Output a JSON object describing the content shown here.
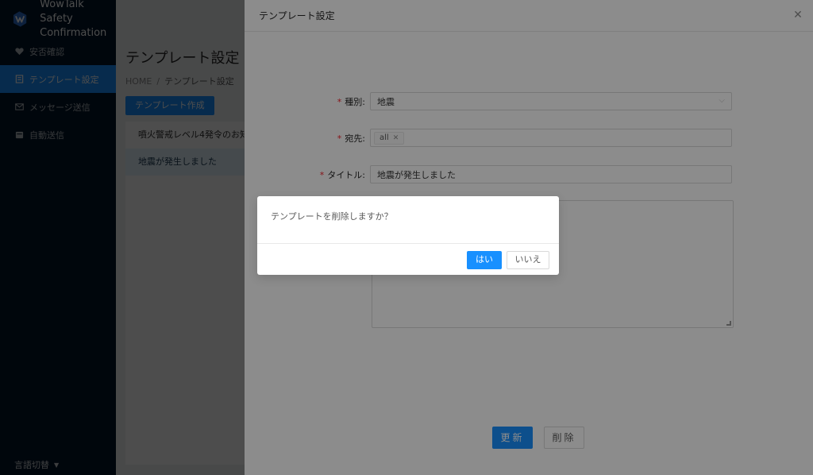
{
  "app": {
    "brand_line1": "WowTalk",
    "brand_line2": "Safety Confirmation",
    "logo_icon": "wowtalk-logo-icon"
  },
  "sidebar": {
    "items": [
      {
        "label": "安否確認",
        "icon": "heart-icon",
        "active": false
      },
      {
        "label": "テンプレート設定",
        "icon": "document-icon",
        "active": true
      },
      {
        "label": "メッセージ送信",
        "icon": "mail-icon",
        "active": false
      },
      {
        "label": "自動送信",
        "icon": "calendar-icon",
        "active": false
      }
    ],
    "lang_switch": "言語切替"
  },
  "main": {
    "page_title": "テンプレート設定",
    "breadcrumb_home": "HOME",
    "breadcrumb_sep": "/",
    "breadcrumb_current": "テンプレート設定",
    "create_button": "テンプレート作成",
    "list": [
      {
        "label": "噴火警戒レベル4発令のお知ら",
        "selected": false
      },
      {
        "label": "地震が発生しました",
        "selected": true
      }
    ]
  },
  "drawer": {
    "title": "テンプレート設定",
    "close_icon": "close-icon",
    "required_mark": "*",
    "type_label": "種別:",
    "type_value": "地震",
    "dest_label": "宛先:",
    "dest_tag": "all",
    "title_label": "タイトル:",
    "title_value": "地震が発生しました",
    "update_button": "更新",
    "delete_button": "削除"
  },
  "dialog": {
    "message": "テンプレートを削除しますか？",
    "yes_button": "はい",
    "no_button": "いいえ"
  },
  "colors": {
    "primary": "#1890ff",
    "sidebar_bg": "#001529",
    "required": "#f5222d"
  }
}
